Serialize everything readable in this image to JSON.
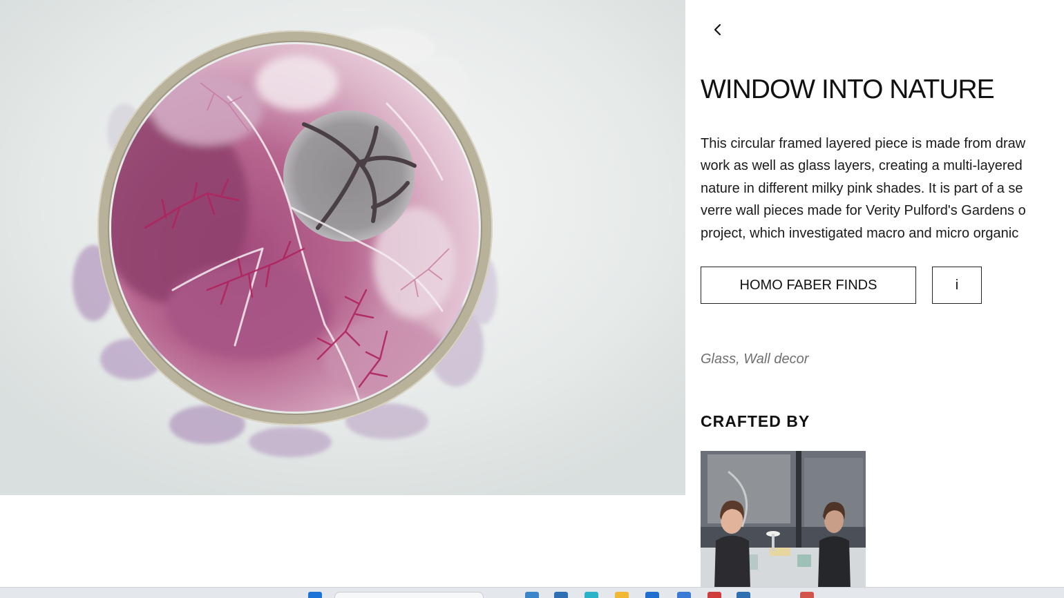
{
  "product": {
    "title": "WINDOW INTO NATURE",
    "description_lines": [
      "This circular framed layered piece is made from draw",
      "work as well as glass layers, creating a multi-layered",
      "nature in different milky pink shades. It is part of a se",
      "verre wall pieces made for Verity Pulford's Gardens o",
      "project, which investigated macro and micro organic"
    ],
    "categories": "Glass, Wall decor"
  },
  "actions": {
    "finds_label": "HOMO FABER FINDS",
    "info_label": "i"
  },
  "crafted_by": {
    "heading": "CRAFTED BY"
  },
  "icons": {
    "back": "chevron-left-icon",
    "taskbar": [
      "windows-start-icon",
      "taskbar-search",
      "file-explorer-icon",
      "edge-icon",
      "folder-icon",
      "store-icon",
      "mail-icon",
      "app-icon"
    ]
  },
  "colors": {
    "text": "#111111",
    "muted": "#6f6f6f",
    "border": "#222222",
    "artwork_pink": "#a8336e",
    "artwork_frame": "#b9b29a"
  }
}
